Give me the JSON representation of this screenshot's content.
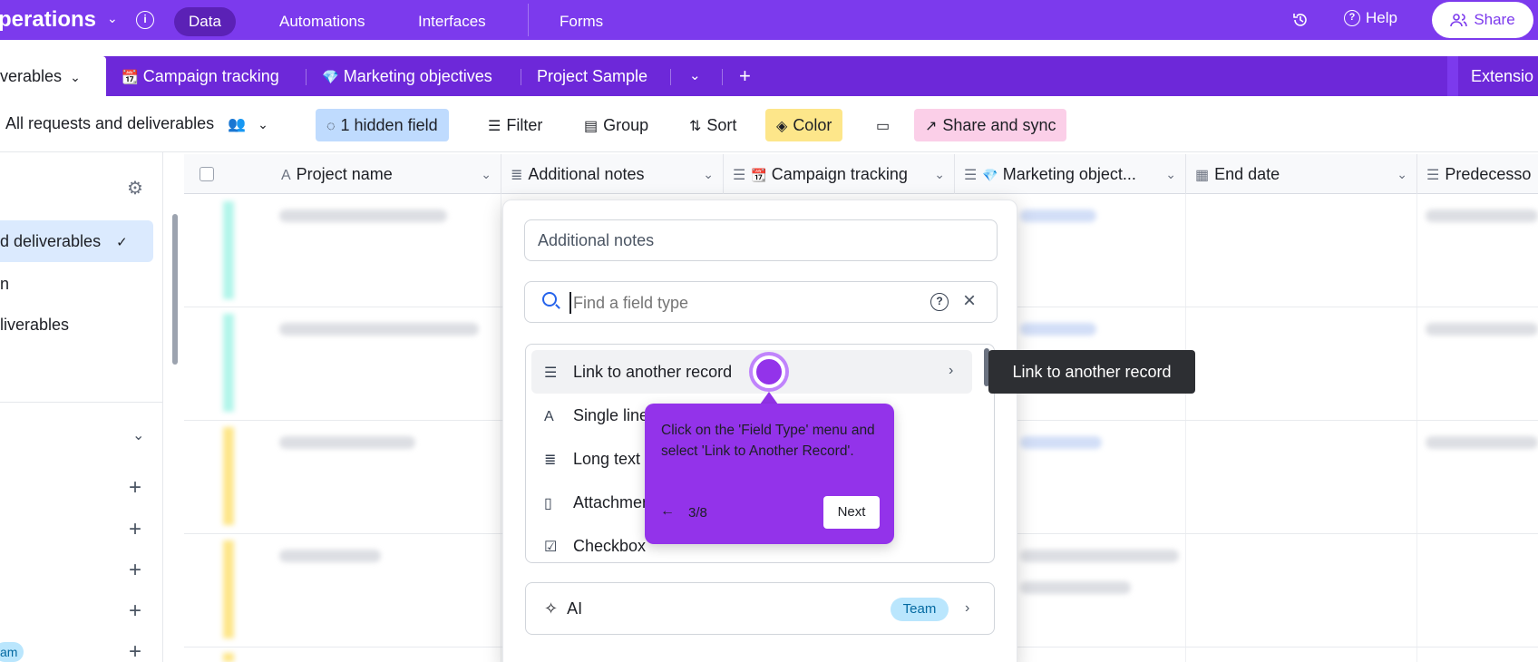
{
  "topbar": {
    "base_name": "perations",
    "nav": [
      "Data",
      "Automations",
      "Interfaces",
      "Forms"
    ],
    "help_label": "Help",
    "share_label": "Share"
  },
  "tabs": {
    "active": "verables",
    "items": [
      "Campaign tracking",
      "Marketing objectives",
      "Project Sample"
    ],
    "extensions_label": "Extensio"
  },
  "viewbar": {
    "view_name": "All requests and deliverables",
    "hidden_fields": "1 hidden field",
    "filter": "Filter",
    "group": "Group",
    "sort": "Sort",
    "color": "Color",
    "share_sync": "Share and sync"
  },
  "sidebar": {
    "items": [
      "d deliverables",
      "n",
      "liverables"
    ],
    "badge": "am"
  },
  "grid": {
    "columns": [
      "Project name",
      "Additional notes",
      "Campaign tracking",
      "Marketing object...",
      "End date",
      "Predecesso"
    ]
  },
  "popup": {
    "field_name_value": "Additional notes",
    "search_placeholder": "Find a field type",
    "field_types": [
      "Link to another record",
      "Single line",
      "Long text",
      "Attachment",
      "Checkbox"
    ],
    "ai_label": "AI",
    "team_badge": "Team"
  },
  "tooltip": {
    "text": "Link to another record"
  },
  "guide": {
    "text": "Click on the 'Field Type' menu and select 'Link to Another Record'.",
    "step": "3/8",
    "next_label": "Next"
  },
  "colors": {
    "brand": "#7c3aed",
    "guide": "#9333ea",
    "hidden_field_bg": "#bfdbfe",
    "color_bg": "#fde68a",
    "share_sync_bg": "#fbcfe8"
  },
  "icons": [
    "info-icon",
    "history-icon",
    "help-icon",
    "share-users-icon",
    "calendar-emoji-icon",
    "gem-emoji-icon",
    "chevron-down-icon",
    "plus-icon",
    "eye-off-icon",
    "filter-icon",
    "group-icon",
    "sort-icon",
    "paint-bucket-icon",
    "row-height-icon",
    "share-sync-icon",
    "gear-icon",
    "check-icon",
    "search-icon",
    "question-icon",
    "close-icon",
    "sparkle-icon",
    "chevron-right-icon",
    "arrow-left-icon"
  ]
}
